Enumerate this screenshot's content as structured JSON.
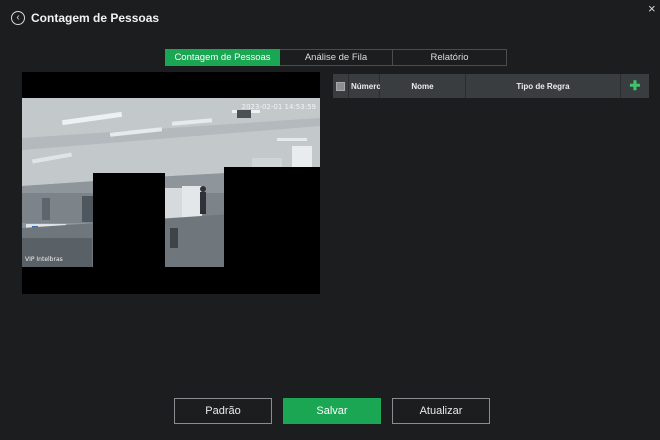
{
  "header": {
    "title": "Contagem de Pessoas",
    "back_icon": "‹",
    "close_icon": "×"
  },
  "tabs": [
    {
      "label": "Contagem de Pessoas",
      "active": true
    },
    {
      "label": "Análise de Fila",
      "active": false
    },
    {
      "label": "Relatório",
      "active": false
    }
  ],
  "video": {
    "timestamp": "2023-02-01 14:53:59",
    "camera_name": "VIP Intelbras"
  },
  "table": {
    "columns": {
      "number": "Número",
      "name": "Nome",
      "rule_type": "Tipo de Regra",
      "add_icon": "✚"
    },
    "rows": []
  },
  "footer": {
    "default_label": "Padrão",
    "save_label": "Salvar",
    "refresh_label": "Atualizar"
  },
  "colors": {
    "accent": "#1aa653",
    "background": "#1b1d1f",
    "table_header": "#3a3d40"
  }
}
